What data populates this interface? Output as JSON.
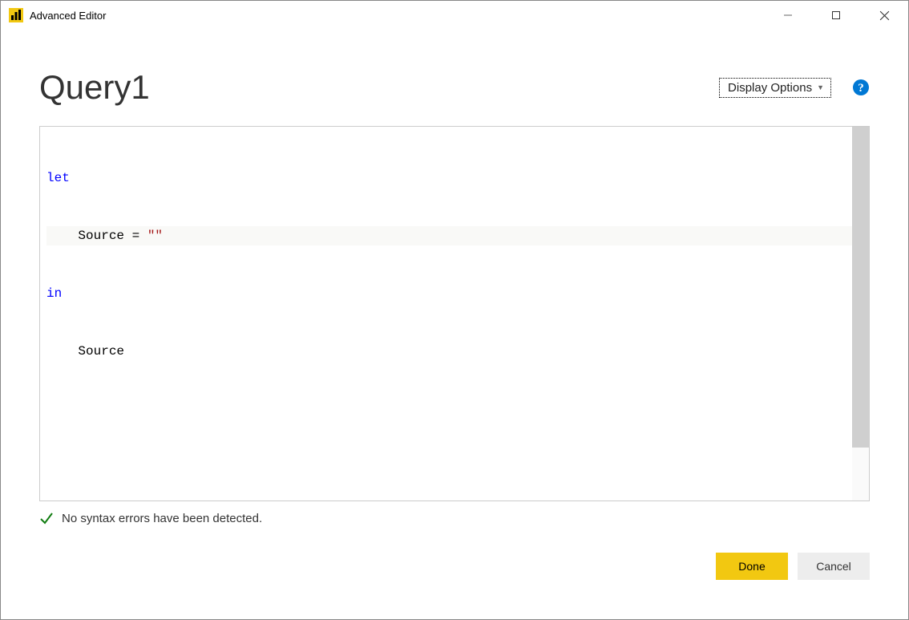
{
  "window": {
    "title": "Advanced Editor"
  },
  "header": {
    "query_name": "Query1",
    "display_options_label": "Display Options"
  },
  "editor": {
    "code": {
      "line1_kw": "let",
      "line2_indent": "    ",
      "line2_a": "Source = ",
      "line2_str": "\"\"",
      "line3_kw": "in",
      "line4_indent": "    ",
      "line4_text": "Source"
    }
  },
  "status": {
    "message": "No syntax errors have been detected."
  },
  "footer": {
    "done_label": "Done",
    "cancel_label": "Cancel"
  }
}
